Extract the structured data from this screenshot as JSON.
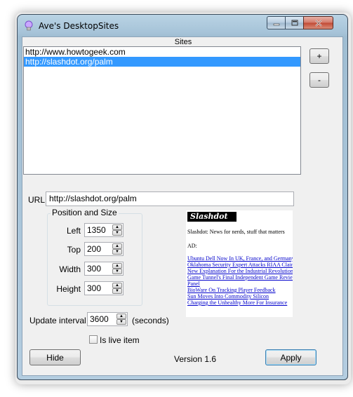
{
  "window": {
    "title": "Ave's DesktopSites"
  },
  "sites": {
    "label": "Sites",
    "items": [
      "http://www.howtogeek.com",
      "http://slashdot.org/palm"
    ],
    "selected_index": 1,
    "add_label": "+",
    "remove_label": "-"
  },
  "url": {
    "label": "URL",
    "value": "http://slashdot.org/palm"
  },
  "position": {
    "title": "Position and Size",
    "left_label": "Left",
    "left_value": "1350",
    "top_label": "Top",
    "top_value": "200",
    "width_label": "Width",
    "width_value": "300",
    "height_label": "Height",
    "height_value": "300"
  },
  "interval": {
    "label": "Update interval",
    "value": "3600",
    "unit": "(seconds)"
  },
  "live": {
    "label": "Is live item",
    "checked": false
  },
  "preview": {
    "logo": "Slashdot",
    "headline": "Slashdot: News for nerds, stuff that matters",
    "ad_label": "AD:",
    "links": [
      "Ubuntu Dell Now In UK, France, and Germany",
      "Oklahoma Security Expert Attacks RIAA Claims",
      "New Explanation For the Industrial Revolution",
      "Game Tunnel's Final Independent Game Review",
      "Panel",
      "BioWare On Tracking Player Feedback",
      "Sun Moves Into Commodity Silicon",
      "Charging the Unhealthy More For Insurance"
    ]
  },
  "footer": {
    "hide_label": "Hide",
    "version": "Version 1.6",
    "apply_label": "Apply"
  },
  "colors": {
    "selection": "#3399ff",
    "accent": "#0066cc"
  }
}
